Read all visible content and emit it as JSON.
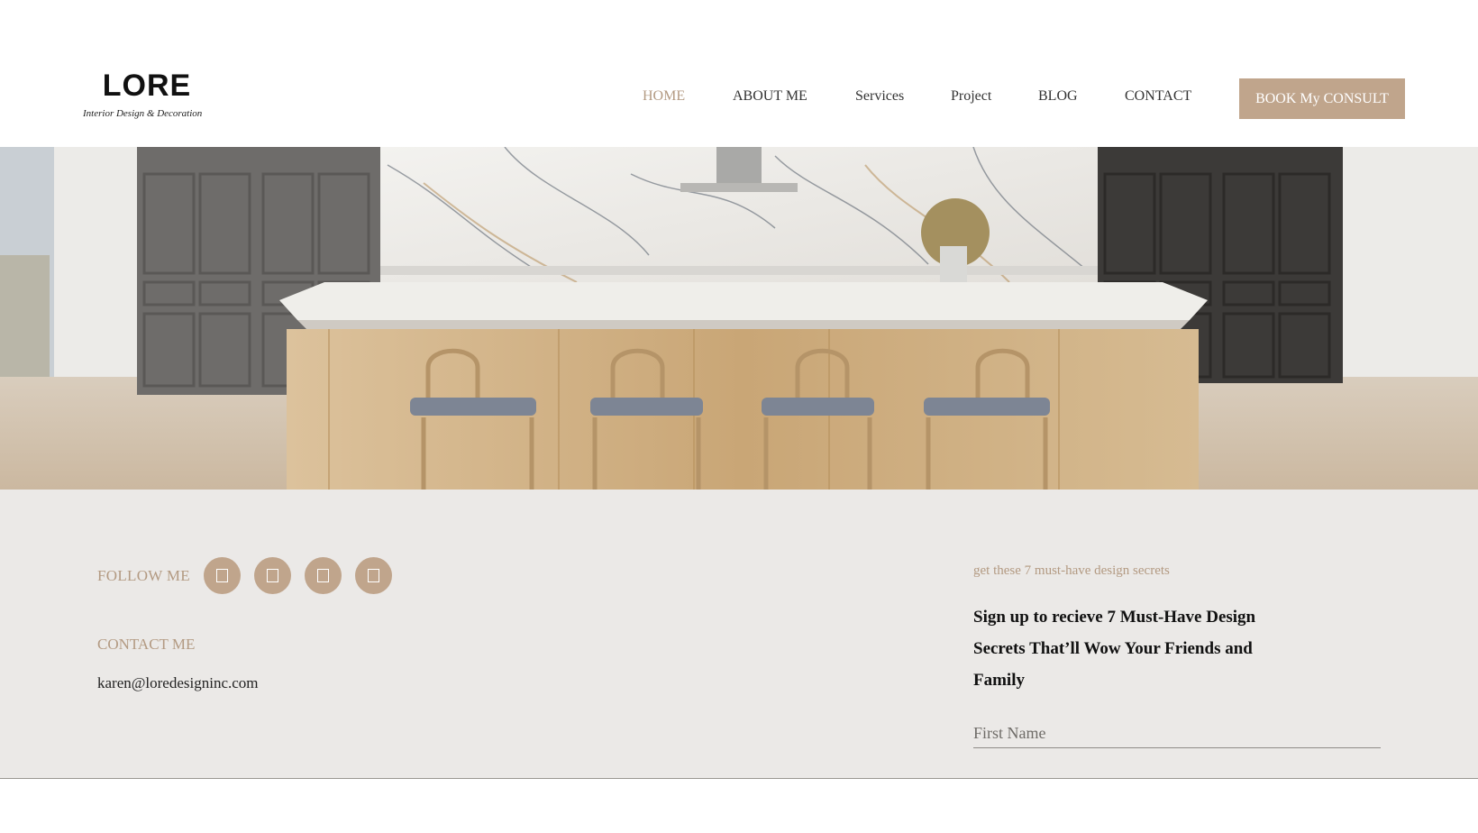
{
  "brand": {
    "name": "LORE",
    "tagline": "Interior Design & Decoration"
  },
  "nav": {
    "items": [
      {
        "label": "HOME",
        "active": true
      },
      {
        "label": "ABOUT ME"
      },
      {
        "label": "Services"
      },
      {
        "label": "Project"
      },
      {
        "label": "BLOG"
      },
      {
        "label": "CONTACT"
      }
    ],
    "cta_label": "BOOK My CONSULT"
  },
  "hero": {
    "image": "kitchen-island-photo"
  },
  "footer": {
    "follow_label": "FOLLOW ME",
    "social_icons": [
      "social-icon-1",
      "social-icon-2",
      "social-icon-3",
      "social-icon-4"
    ],
    "contact_label": "CONTACT ME",
    "contact_email": "karen@loredesigninc.com",
    "promo_kicker": "get these 7 must-have design secrets",
    "promo_title": "Sign up to recieve 7 Must-Have Design Secrets That’ll Wow Your Friends and Family",
    "first_name_placeholder": "First Name"
  },
  "colors": {
    "accent": "#c0a58c",
    "accent_text": "#b39a82",
    "footer_bg": "#ebe9e7"
  }
}
